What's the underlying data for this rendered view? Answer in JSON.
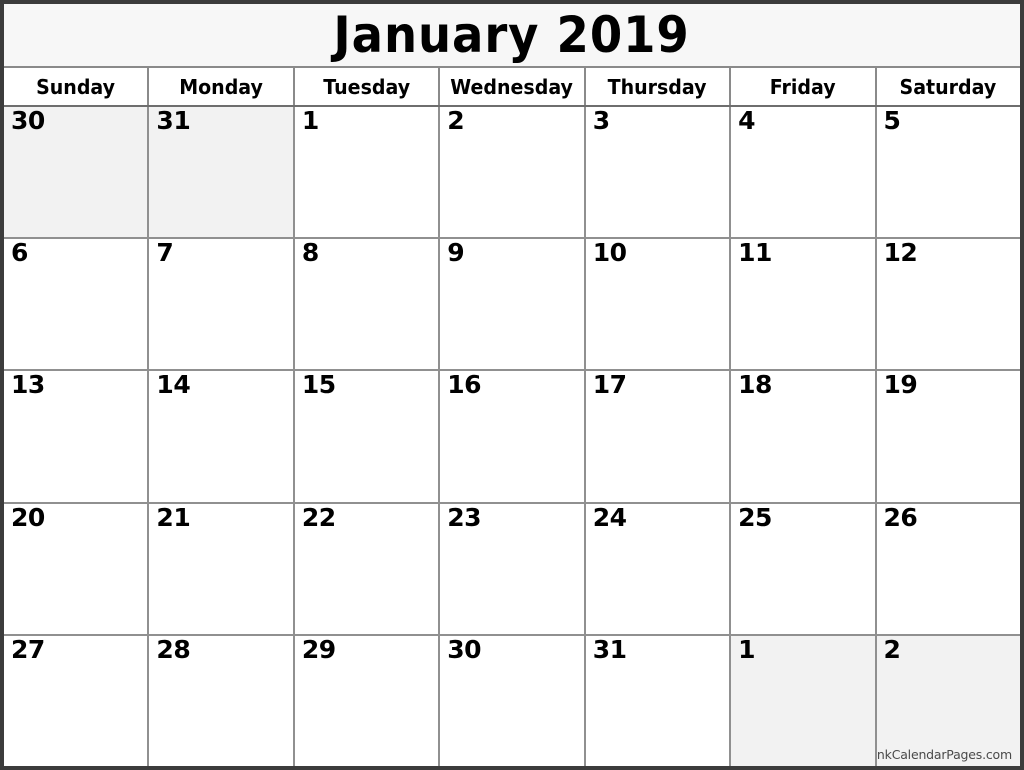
{
  "page": {
    "title": "January 2019",
    "month_name": "January",
    "year": "2019",
    "watermark": "© BlankCalendarPages.com"
  },
  "colors": {
    "outer_border": "#3c3c3c",
    "grid_line": "#909090",
    "title_background": "#f7f7f7",
    "header_background": "#ffffff",
    "cell_background": "#ffffff",
    "outside_cell_background": "#f2f2f2",
    "text": "#000000",
    "watermark_text": "#4a4a4a"
  },
  "weekdays": [
    {
      "label": "Sunday"
    },
    {
      "label": "Monday"
    },
    {
      "label": "Tuesday"
    },
    {
      "label": "Wednesday"
    },
    {
      "label": "Thursday"
    },
    {
      "label": "Friday"
    },
    {
      "label": "Saturday"
    }
  ],
  "weeks": [
    {
      "days": [
        {
          "number": "30",
          "outside": true
        },
        {
          "number": "31",
          "outside": true
        },
        {
          "number": "1",
          "outside": false
        },
        {
          "number": "2",
          "outside": false
        },
        {
          "number": "3",
          "outside": false
        },
        {
          "number": "4",
          "outside": false
        },
        {
          "number": "5",
          "outside": false
        }
      ]
    },
    {
      "days": [
        {
          "number": "6",
          "outside": false
        },
        {
          "number": "7",
          "outside": false
        },
        {
          "number": "8",
          "outside": false
        },
        {
          "number": "9",
          "outside": false
        },
        {
          "number": "10",
          "outside": false
        },
        {
          "number": "11",
          "outside": false
        },
        {
          "number": "12",
          "outside": false
        }
      ]
    },
    {
      "days": [
        {
          "number": "13",
          "outside": false
        },
        {
          "number": "14",
          "outside": false
        },
        {
          "number": "15",
          "outside": false
        },
        {
          "number": "16",
          "outside": false
        },
        {
          "number": "17",
          "outside": false
        },
        {
          "number": "18",
          "outside": false
        },
        {
          "number": "19",
          "outside": false
        }
      ]
    },
    {
      "days": [
        {
          "number": "20",
          "outside": false
        },
        {
          "number": "21",
          "outside": false
        },
        {
          "number": "22",
          "outside": false
        },
        {
          "number": "23",
          "outside": false
        },
        {
          "number": "24",
          "outside": false
        },
        {
          "number": "25",
          "outside": false
        },
        {
          "number": "26",
          "outside": false
        }
      ]
    },
    {
      "days": [
        {
          "number": "27",
          "outside": false
        },
        {
          "number": "28",
          "outside": false
        },
        {
          "number": "29",
          "outside": false
        },
        {
          "number": "30",
          "outside": false
        },
        {
          "number": "31",
          "outside": false
        },
        {
          "number": "1",
          "outside": true
        },
        {
          "number": "2",
          "outside": true
        }
      ]
    }
  ]
}
